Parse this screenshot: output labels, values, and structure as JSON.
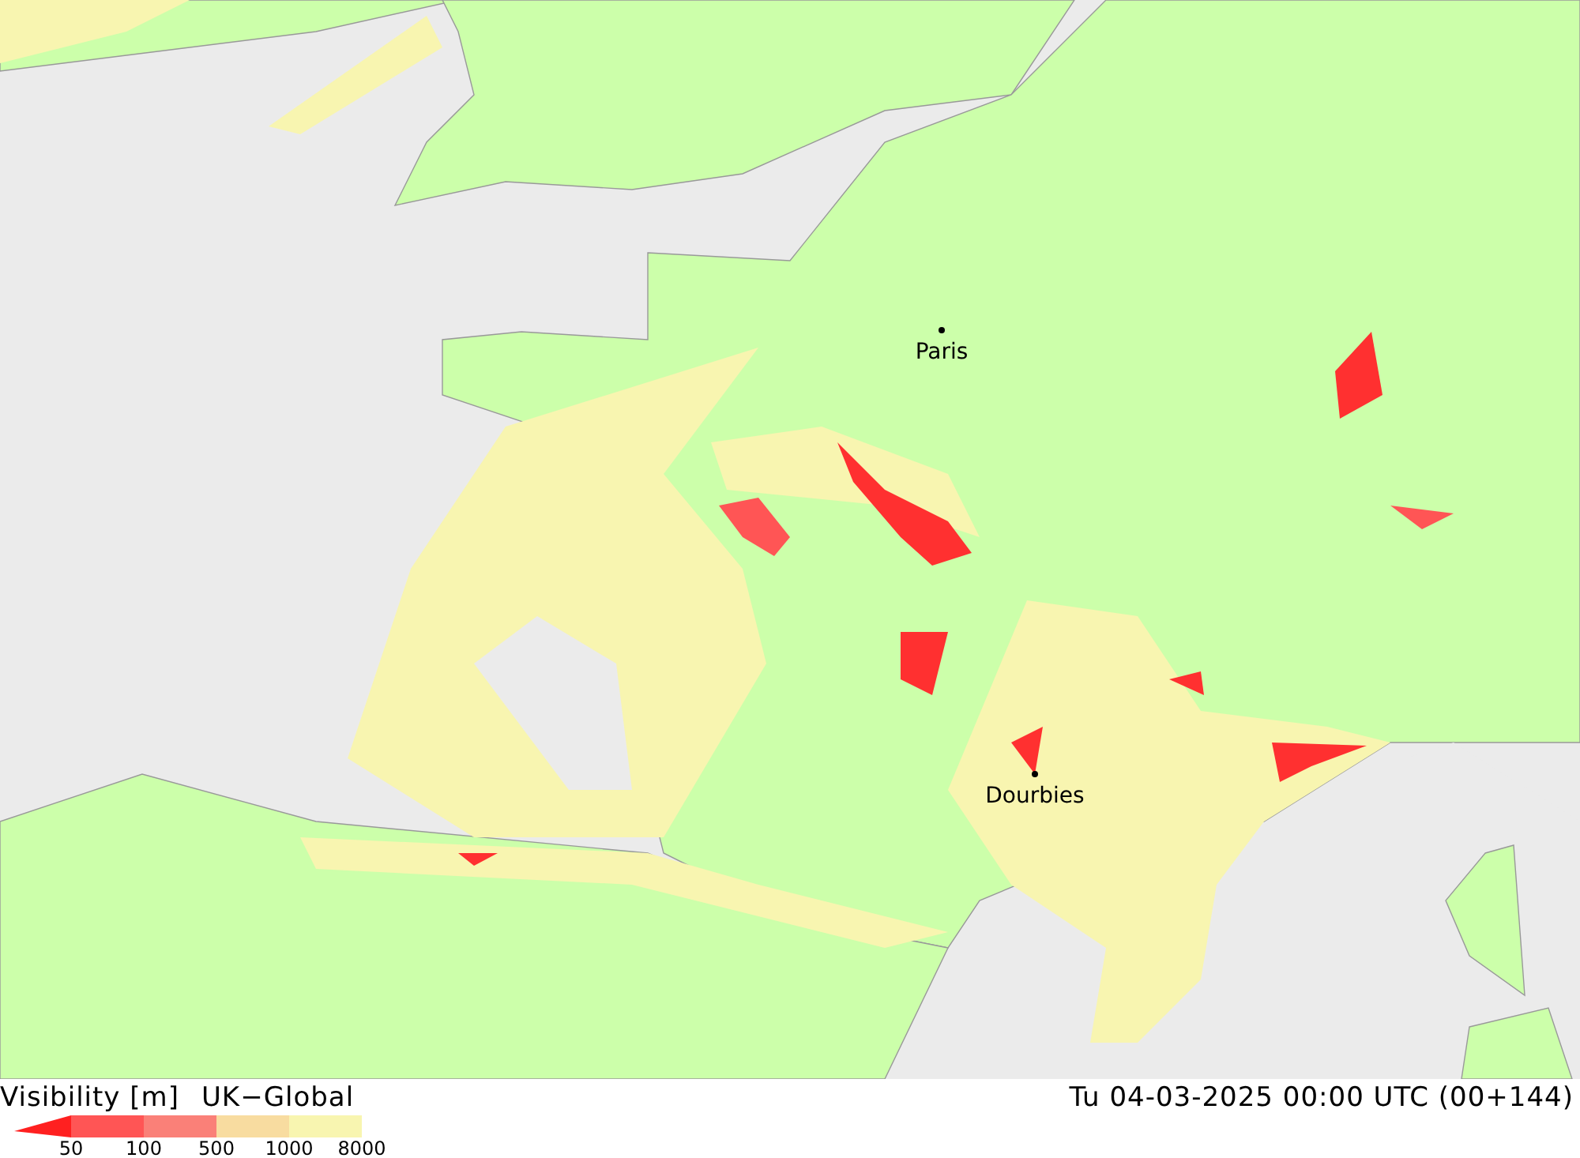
{
  "map": {
    "cities": [
      {
        "name": "Paris"
      },
      {
        "name": "Dourbies"
      }
    ]
  },
  "legend": {
    "quantity": "Visibility [m]",
    "model": "UK−Global",
    "valid_time": "Tu 04-03-2025 00:00 UTC (00+144)",
    "bands": [
      {
        "color": "#ff2020"
      },
      {
        "color": "#ff5555"
      },
      {
        "color": "#fa8078"
      },
      {
        "color": "#f8dca0"
      },
      {
        "color": "#f8f5b0"
      }
    ],
    "labels": [
      "50",
      "100",
      "500",
      "1000",
      "8000"
    ]
  }
}
